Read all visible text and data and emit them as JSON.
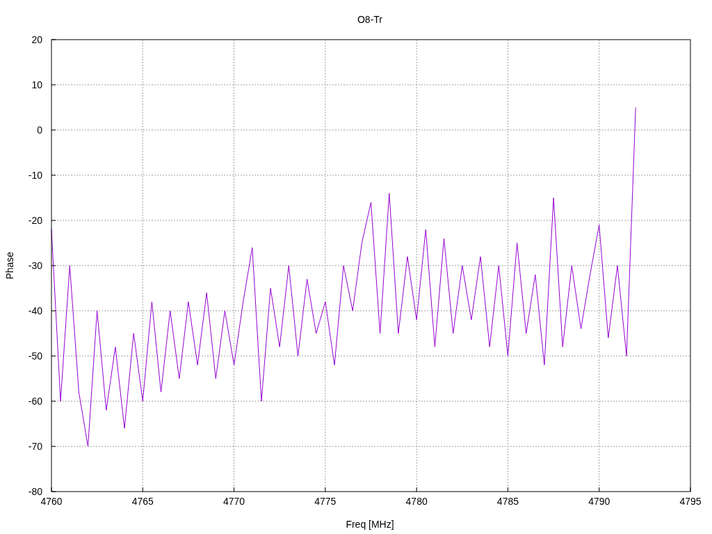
{
  "chart_data": {
    "type": "line",
    "grid": true,
    "title": "O8-Tr",
    "xlabel": "Freq [MHz]",
    "ylabel": "Phase",
    "xlim": [
      4760,
      4795
    ],
    "ylim": [
      -80,
      20
    ],
    "xticks": [
      4760,
      4765,
      4770,
      4775,
      4780,
      4785,
      4790,
      4795
    ],
    "yticks": [
      -80,
      -70,
      -60,
      -50,
      -40,
      -30,
      -20,
      -10,
      0,
      10,
      20
    ],
    "x": [
      4760,
      4760.5,
      4761,
      4761.5,
      4762,
      4762.5,
      4763,
      4763.5,
      4764,
      4764.5,
      4765,
      4765.5,
      4766,
      4766.5,
      4767,
      4767.5,
      4768,
      4768.5,
      4769,
      4769.5,
      4770,
      4770.5,
      4771,
      4771.5,
      4772,
      4772.5,
      4773,
      4773.5,
      4774,
      4774.5,
      4775,
      4775.5,
      4776,
      4776.5,
      4777,
      4777.5,
      4778,
      4778.5,
      4779,
      4779.5,
      4780,
      4780.5,
      4781,
      4781.5,
      4782,
      4782.5,
      4783,
      4783.5,
      4784,
      4784.5,
      4785,
      4785.5,
      4786,
      4786.5,
      4787,
      4787.5,
      4788,
      4788.5,
      4789,
      4789.5,
      4790,
      4790.5,
      4791,
      4791.5,
      4792
    ],
    "series": [
      {
        "color": "#9400d3",
        "values": [
          -22,
          -60,
          -30,
          -58,
          -70,
          -40,
          -62,
          -48,
          -66,
          -45,
          -60,
          -38,
          -58,
          -40,
          -55,
          -38,
          -52,
          -36,
          -55,
          -40,
          -52,
          -38,
          -26,
          -60,
          -35,
          -48,
          -30,
          -50,
          -33,
          -45,
          -38,
          -52,
          -30,
          -40,
          -25,
          -16,
          -45,
          -14,
          -45,
          -28,
          -42,
          -22,
          -48,
          -24,
          -45,
          -30,
          -42,
          -28,
          -48,
          -30,
          -50,
          -25,
          -45,
          -32,
          -52,
          -15,
          -48,
          -30,
          -44,
          -32,
          -21,
          -46,
          -30,
          -50,
          5
        ]
      }
    ]
  }
}
